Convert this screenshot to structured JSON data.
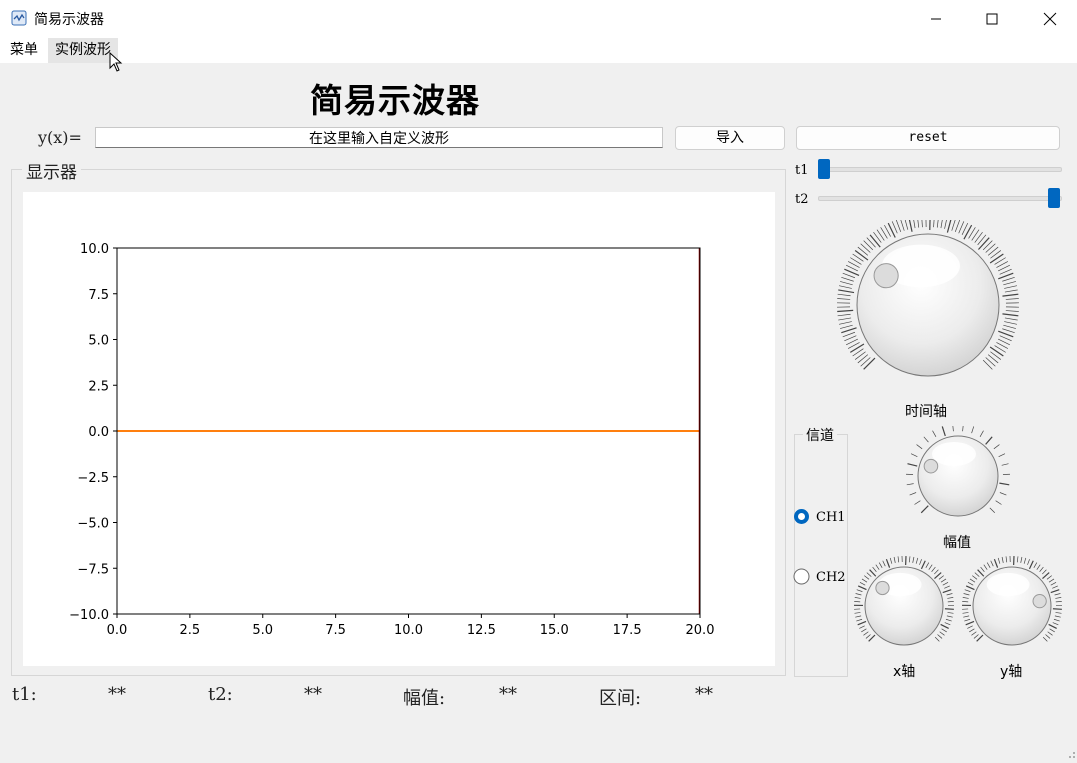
{
  "window": {
    "title": "简易示波器"
  },
  "menu": {
    "items": [
      "菜单",
      "实例波形"
    ]
  },
  "header": {
    "title": "简易示波器"
  },
  "expression": {
    "label": "y(x)=",
    "value": "在这里输入自定义波形"
  },
  "buttons": {
    "import": "导入",
    "reset": "reset"
  },
  "display": {
    "title": "显示器"
  },
  "sliders": {
    "t1": {
      "label": "t1",
      "value": 0
    },
    "t2": {
      "label": "t2",
      "value": 1
    }
  },
  "knobs": {
    "time": "时间轴",
    "amplitude": "幅值",
    "x_axis": "x轴",
    "y_axis": "y轴"
  },
  "channel": {
    "title": "信道",
    "options": [
      "CH1",
      "CH2"
    ],
    "selected": "CH1"
  },
  "status": {
    "t1_label": "t1:",
    "t1_value": "**",
    "t2_label": "t2:",
    "t2_value": "**",
    "amp_label": "幅值:",
    "amp_value": "**",
    "range_label": "区间:",
    "range_value": "**"
  },
  "colors": {
    "accent": "#0067c0",
    "signal": "#ff7f0e"
  },
  "chart_data": {
    "type": "line",
    "xlim": [
      0,
      20
    ],
    "ylim": [
      -10,
      10
    ],
    "x_ticks": [
      "0.0",
      "2.5",
      "5.0",
      "7.5",
      "10.0",
      "12.5",
      "15.0",
      "17.5",
      "20.0"
    ],
    "y_ticks": [
      "10.0",
      "7.5",
      "5.0",
      "2.5",
      "0.0",
      "−2.5",
      "−5.0",
      "−7.5",
      "−10.0"
    ],
    "series": [
      {
        "x": [
          0,
          20
        ],
        "y": [
          0,
          0
        ]
      }
    ],
    "grid": false
  }
}
